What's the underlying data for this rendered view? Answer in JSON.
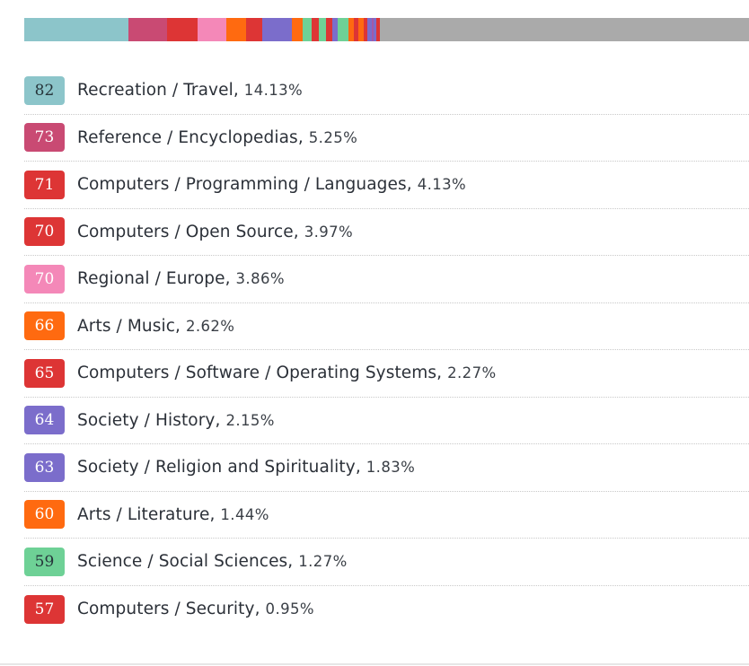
{
  "stacked_bar": {
    "segments": [
      {
        "color": "#8cc5ca",
        "share": 14.13
      },
      {
        "color": "#c94a73",
        "share": 5.25
      },
      {
        "color": "#dd3535",
        "share": 4.13
      },
      {
        "color": "#f488b8",
        "share": 3.97
      },
      {
        "color": "#ff6a10",
        "share": 2.62
      },
      {
        "color": "#dd3535",
        "share": 2.27
      },
      {
        "color": "#7b6dcb",
        "share": 3.98
      },
      {
        "color": "#ff6a10",
        "share": 1.44
      },
      {
        "color": "#6ed196",
        "share": 1.27
      },
      {
        "color": "#dd3535",
        "share": 0.95
      },
      {
        "color": "#6ed196",
        "share": 0.95
      },
      {
        "color": "#dd3535",
        "share": 0.85
      },
      {
        "color": "#7b6dcb",
        "share": 0.75
      },
      {
        "color": "#6ed196",
        "share": 1.5
      },
      {
        "color": "#ff6a10",
        "share": 0.75
      },
      {
        "color": "#dd3535",
        "share": 0.6
      },
      {
        "color": "#ff6a10",
        "share": 0.65
      },
      {
        "color": "#dd3535",
        "share": 0.6
      },
      {
        "color": "#7b6dcb",
        "share": 0.55
      },
      {
        "color": "#a25aa8",
        "share": 0.3
      },
      {
        "color": "#7b6dcb",
        "share": 0.3
      },
      {
        "color": "#dd3535",
        "share": 0.5
      },
      {
        "color": "#aaaaaa",
        "share": 51.7
      }
    ]
  },
  "categories": [
    {
      "score": "82",
      "name": "Recreation / Travel",
      "percent": "14.13%",
      "color": "#8cc5ca",
      "dark_text": true
    },
    {
      "score": "73",
      "name": "Reference / Encyclopedias",
      "percent": "5.25%",
      "color": "#c94a73",
      "dark_text": false
    },
    {
      "score": "71",
      "name": "Computers / Programming / Languages",
      "percent": "4.13%",
      "color": "#dd3535",
      "dark_text": false
    },
    {
      "score": "70",
      "name": "Computers / Open Source",
      "percent": "3.97%",
      "color": "#dd3535",
      "dark_text": false
    },
    {
      "score": "70",
      "name": "Regional / Europe",
      "percent": "3.86%",
      "color": "#f488b8",
      "dark_text": false
    },
    {
      "score": "66",
      "name": "Arts / Music",
      "percent": "2.62%",
      "color": "#ff6a10",
      "dark_text": false
    },
    {
      "score": "65",
      "name": "Computers / Software / Operating Systems",
      "percent": "2.27%",
      "color": "#dd3535",
      "dark_text": false
    },
    {
      "score": "64",
      "name": "Society / History",
      "percent": "2.15%",
      "color": "#7b6dcb",
      "dark_text": false
    },
    {
      "score": "63",
      "name": "Society / Religion and Spirituality",
      "percent": "1.83%",
      "color": "#7b6dcb",
      "dark_text": false
    },
    {
      "score": "60",
      "name": "Arts / Literature",
      "percent": "1.44%",
      "color": "#ff6a10",
      "dark_text": false
    },
    {
      "score": "59",
      "name": "Science / Social Sciences",
      "percent": "1.27%",
      "color": "#6ed196",
      "dark_text": true
    },
    {
      "score": "57",
      "name": "Computers / Security",
      "percent": "0.95%",
      "color": "#dd3535",
      "dark_text": false
    }
  ],
  "separator": ", "
}
